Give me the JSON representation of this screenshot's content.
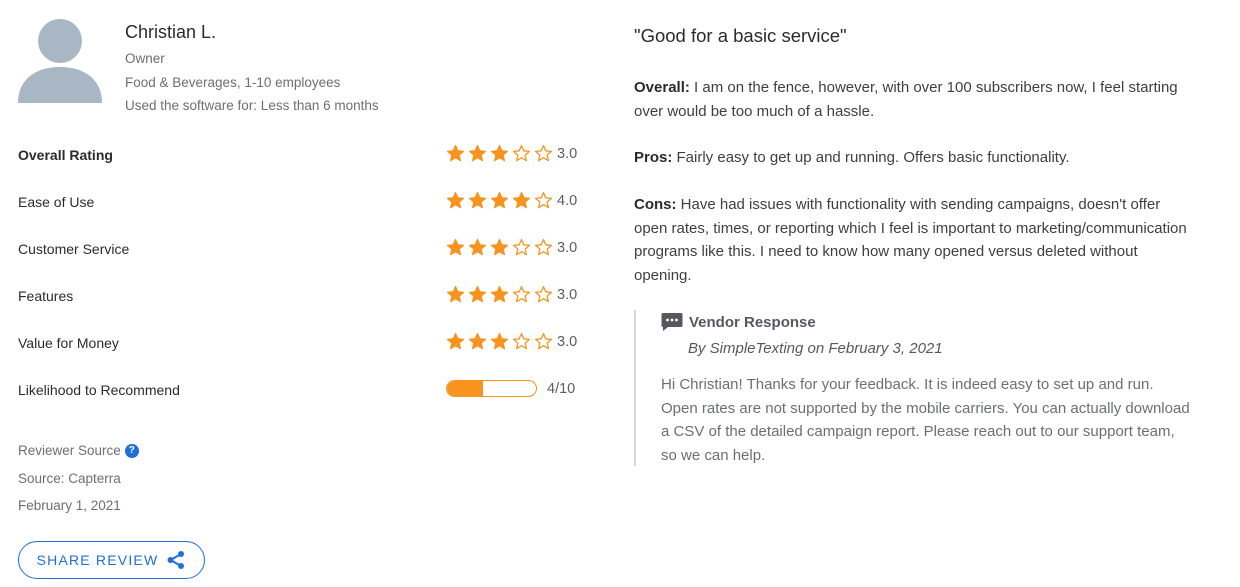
{
  "reviewer": {
    "name": "Christian L.",
    "role": "Owner",
    "company": "Food & Beverages, 1-10 employees",
    "usage": "Used the software for: Less than 6 months"
  },
  "ratings": [
    {
      "label": "Overall Rating",
      "value": "3.0",
      "stars": 3
    },
    {
      "label": "Ease of Use",
      "value": "4.0",
      "stars": 4
    },
    {
      "label": "Customer Service",
      "value": "3.0",
      "stars": 3
    },
    {
      "label": "Features",
      "value": "3.0",
      "stars": 3
    },
    {
      "label": "Value for Money",
      "value": "3.0",
      "stars": 3
    }
  ],
  "likelihood": {
    "label": "Likelihood to Recommend",
    "value": "4/10",
    "fraction": 0.4
  },
  "source": {
    "title": "Reviewer Source",
    "name": "Source: Capterra",
    "date": "February 1, 2021"
  },
  "share_label": "SHARE REVIEW",
  "review": {
    "title": "\"Good for a basic service\"",
    "overall_label": "Overall:",
    "overall": "I am on the fence, however, with over 100 subscribers now, I feel starting over would be too much of a hassle.",
    "pros_label": "Pros:",
    "pros": "Fairly easy to get up and running. Offers basic functionality.",
    "cons_label": "Cons:",
    "cons": "Have had issues with functionality with sending campaigns, doesn't offer open rates, times, or reporting which I feel is important to marketing/communication programs like this. I need to know how many opened versus deleted without opening."
  },
  "vendor": {
    "heading": "Vendor Response",
    "by": "By SimpleTexting on February 3, 2021",
    "text": "Hi Christian! Thanks for your feedback. It is indeed easy to set up and run. Open rates are not supported by the mobile carriers. You can actually download a CSV of the detailed campaign report. Please reach out to our support team, so we can help."
  },
  "colors": {
    "star": "#f7931e",
    "accent": "#1f6fd6",
    "avatar": "#a9b6c3"
  },
  "icons": {
    "avatar": "user-avatar-icon",
    "star": "star-icon",
    "help": "question-circle-icon",
    "share": "share-icon",
    "vendor": "chat-bubble-icon"
  }
}
